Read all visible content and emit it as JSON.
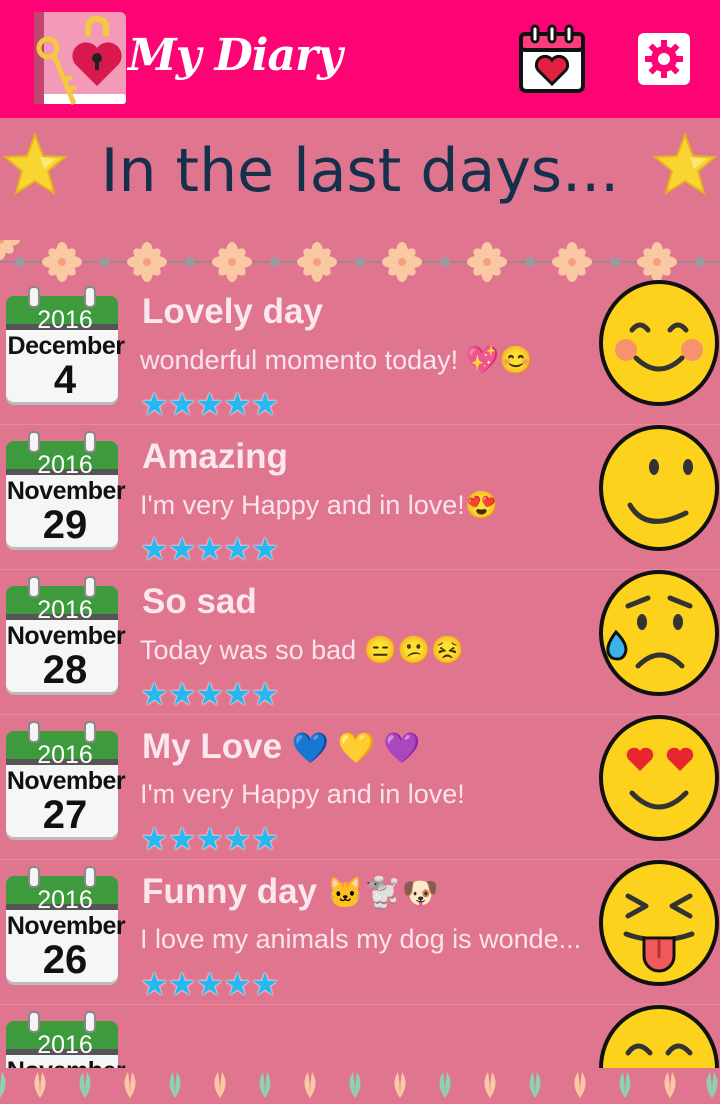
{
  "app": {
    "title": "My Diary"
  },
  "header": {
    "title": "In the last days..."
  },
  "entries": [
    {
      "year": "2016",
      "month": "December",
      "day": "4",
      "title": "Lovely day",
      "title_emoji": "",
      "text": "wonderful momento today! 💖😊",
      "stars": "★★★★★",
      "rating": 5,
      "mood": "blushing-smile"
    },
    {
      "year": "2016",
      "month": "November",
      "day": "29",
      "title": "Amazing",
      "title_emoji": "",
      "text": "I'm very Happy and in love!😍",
      "stars": "★★★★★",
      "rating": 5,
      "mood": "smirk"
    },
    {
      "year": "2016",
      "month": "November",
      "day": "28",
      "title": "So sad",
      "title_emoji": "",
      "text": "Today was so bad 😑😕😣",
      "stars": "★★★★★",
      "rating": 5,
      "mood": "sad-sweat"
    },
    {
      "year": "2016",
      "month": "November",
      "day": "27",
      "title": "My Love",
      "title_emoji": "💙 💛 💜",
      "text": "I'm very Happy and in love!",
      "stars": "★★★★★",
      "rating": 5,
      "mood": "heart-eyes"
    },
    {
      "year": "2016",
      "month": "November",
      "day": "26",
      "title": "Funny day",
      "title_emoji": "🐱🐩🐶",
      "text": "I love my animals my dog is wonde...",
      "stars": "★★★★★",
      "rating": 5,
      "mood": "tongue-out"
    },
    {
      "year": "2016",
      "month": "November",
      "day": "",
      "title": "",
      "title_emoji": "",
      "text": "",
      "stars": "",
      "rating": 0,
      "mood": "laughing"
    }
  ],
  "colors": {
    "appbar": "#fd0475",
    "background": "#e07590",
    "star": "#27b8ef",
    "header_text": "#15304a"
  }
}
